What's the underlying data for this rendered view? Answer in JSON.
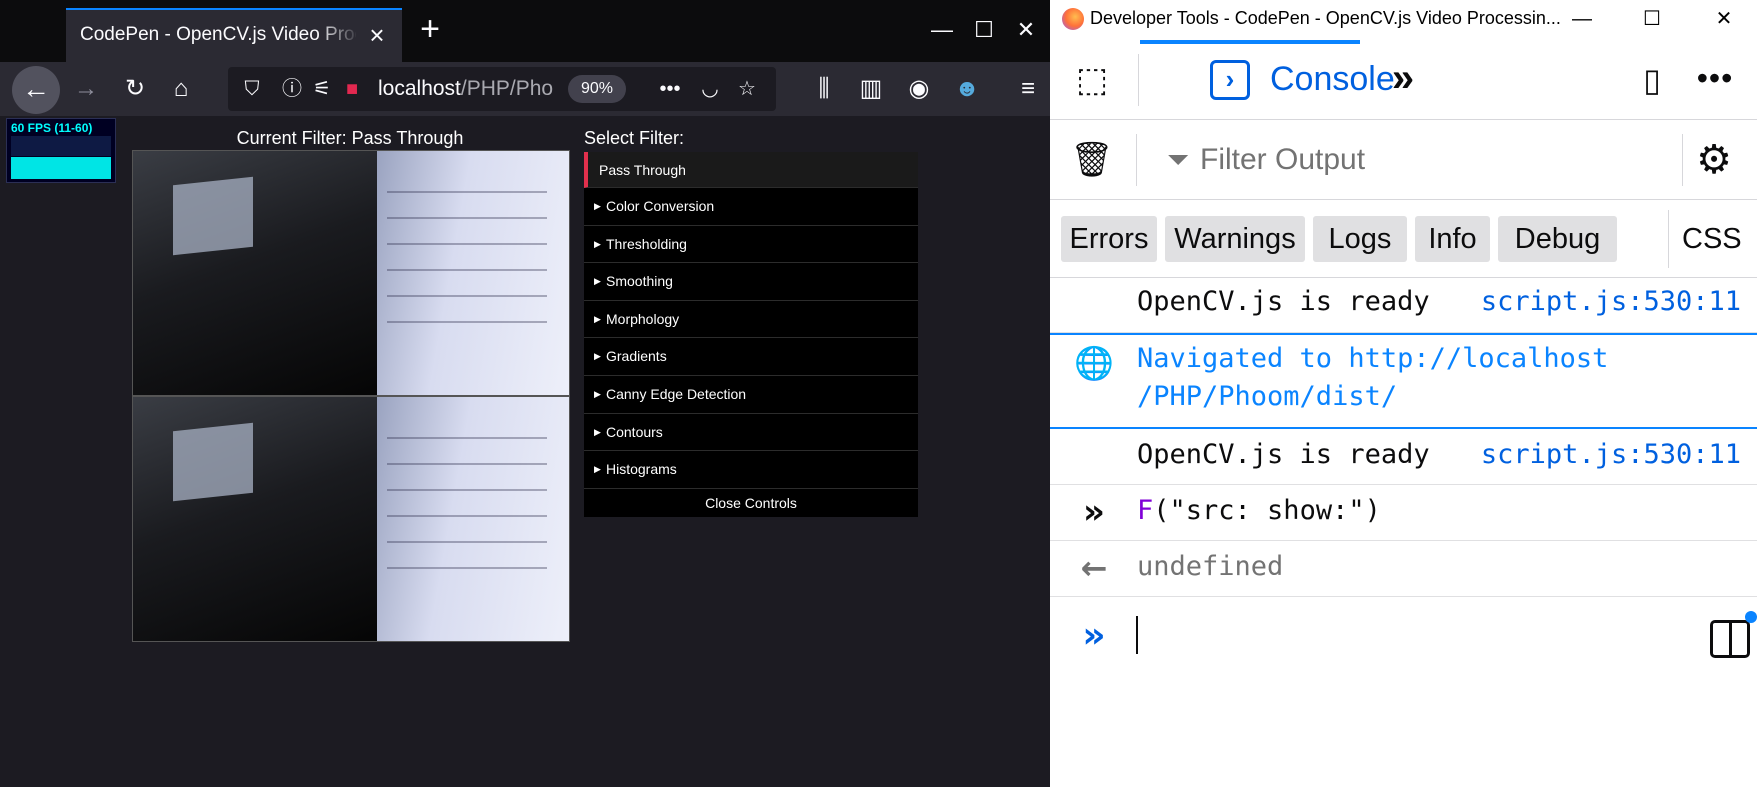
{
  "browser": {
    "tab_title": "CodePen - OpenCV.js Video Processing",
    "url_host": "localhost",
    "url_path": "/PHP/Phoom/dist/",
    "zoom": "90%",
    "controls": {
      "minimize": "—",
      "maximize": "☐",
      "close": "✕"
    }
  },
  "page": {
    "fps_label": "60 FPS (11-60)",
    "current_filter": "Current Filter: Pass Through",
    "select_filter_title": "Select Filter:",
    "filters": [
      {
        "label": "Pass Through",
        "selected": true
      },
      {
        "label": "Color Conversion"
      },
      {
        "label": "Thresholding"
      },
      {
        "label": "Smoothing"
      },
      {
        "label": "Morphology"
      },
      {
        "label": "Gradients"
      },
      {
        "label": "Canny Edge Detection"
      },
      {
        "label": "Contours"
      },
      {
        "label": "Histograms"
      }
    ],
    "close_controls": "Close Controls"
  },
  "devtools": {
    "window_title": "Developer Tools - CodePen - OpenCV.js Video Processin...",
    "console_tab": "Console",
    "filter_placeholder": "Filter Output",
    "levels": [
      "Errors",
      "Warnings",
      "Logs",
      "Info",
      "Debug"
    ],
    "css_label": "CSS",
    "messages": {
      "m1_text": "OpenCV.js is ready",
      "m1_loc": "script.js:530:11",
      "nav_line1": "Navigated to http://localhost",
      "nav_line2": "/PHP/Phoom/dist/",
      "m2_text": "OpenCV.js is ready",
      "m2_loc": "script.js:530:11",
      "input_fn": "F",
      "input_args": "(\"src: show:\")",
      "result": "undefined"
    }
  },
  "colors": {
    "accent": "#0a84ff",
    "selected_filter_border": "#e2304d",
    "fps_text": "#00ffff"
  },
  "icons": {
    "back": "arrow-left-icon",
    "forward": "arrow-right-icon",
    "reload": "reload-icon",
    "home": "home-icon",
    "new_tab": "plus-icon"
  }
}
